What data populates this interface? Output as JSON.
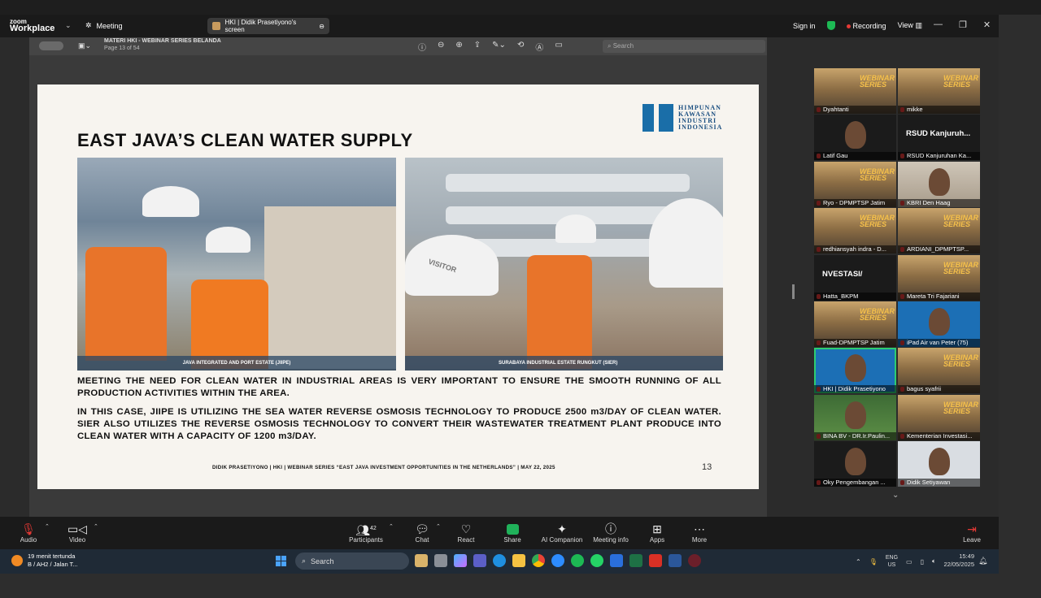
{
  "zoom": {
    "brand_line1": "zoom",
    "brand_line2": "Workplace",
    "meeting_label": "Meeting",
    "screen_chip": "HKI | Didik Prasetiyono's screen",
    "sign_in": "Sign in",
    "recording": "Recording",
    "view": "View"
  },
  "pdf": {
    "doc_title": "MATERI HKI - WEBINAR SERIES BELANDA",
    "page_info": "Page 13 of 54",
    "search_placeholder": "Search"
  },
  "slide": {
    "title": "EAST JAVA’S CLEAN WATER SUPPLY",
    "logo_lines": [
      "HIMPUNAN",
      "KAWASAN",
      "INDUSTRI",
      "INDONESIA"
    ],
    "photo1_caption": "JAVA INTEGRATED AND PORT ESTATE (JIIPE)",
    "photo2_caption": "SURABAYA INDUSTRIAL ESTATE RUNGKUT (SIER)",
    "paragraph1": "MEETING THE NEED FOR CLEAN WATER IN INDUSTRIAL AREAS IS VERY IMPORTANT TO ENSURE THE SMOOTH RUNNING OF ALL PRODUCTION ACTIVITIES WITHIN THE AREA.",
    "paragraph2": "IN THIS CASE, JIIPE IS UTILIZING THE SEA WATER REVERSE OSMOSIS TECHNOLOGY TO PRODUCE 2500 m3/DAY OF CLEAN WATER. SIER ALSO UTILIZES THE REVERSE OSMOSIS TECHNOLOGY TO CONVERT THEIR WASTEWATER TREATMENT PLANT PRODUCE INTO CLEAN WATER WITH A CAPACITY OF 1200 m3/DAY.",
    "footer": "DIDIK PRASETIYONO | HKI | WEBINAR SERIES “EAST JAVA INVESTMENT OPPORTUNITIES IN THE NETHERLANDS” | MAY 22, 2025",
    "page_number": "13",
    "visitor_label": "VISITOR"
  },
  "participants": [
    {
      "name": "Dyahtanti",
      "style": "webinar"
    },
    {
      "name": "mikke",
      "style": "webinar"
    },
    {
      "name": "Latif Gau",
      "style": "dark"
    },
    {
      "name": "RSUD Kanjuruhan Ka...",
      "style": "dark",
      "title": "RSUD  Kanjuruh..."
    },
    {
      "name": "Ryo - DPMPTSP Jatim",
      "style": "webinar"
    },
    {
      "name": "KBRI Den Haag",
      "style": "room"
    },
    {
      "name": "redhiansyah indra - D...",
      "style": "webinar"
    },
    {
      "name": "ARDIANI_DPMPTSP...",
      "style": "webinar"
    },
    {
      "name": "Hatta_BKPM",
      "style": "dark",
      "title": "NVESTASI/"
    },
    {
      "name": "Mareta Tri Fajariani",
      "style": "webinar"
    },
    {
      "name": "Fuad-DPMPTSP Jatim",
      "style": "webinar"
    },
    {
      "name": "iPad Air van Peter (75)",
      "style": "blue"
    },
    {
      "name": "HKI | Didik Prasetiyono",
      "style": "blue",
      "active": true
    },
    {
      "name": "bagus syafrii",
      "style": "webinar"
    },
    {
      "name": "BINA BV - DR.Ir.Paulin...",
      "style": "green"
    },
    {
      "name": "Kementerian Investasi...",
      "style": "webinar"
    },
    {
      "name": "Oky Pengembangan ...",
      "style": "dark"
    },
    {
      "name": "Didik Setiyawan",
      "style": "light"
    }
  ],
  "webinar_tile_text": [
    "WEBINAR",
    "SERIES"
  ],
  "controls": {
    "audio": "Audio",
    "video": "Video",
    "participants": "Participants",
    "participants_count": "42",
    "chat": "Chat",
    "react": "React",
    "share": "Share",
    "ai_companion": "AI Companion",
    "meeting_info": "Meeting info",
    "apps": "Apps",
    "more": "More",
    "leave": "Leave"
  },
  "taskbar": {
    "weather_line1": "19 menit tertunda",
    "weather_line2": "B / AH2 / Jalan T...",
    "search": "Search",
    "lang_line1": "ENG",
    "lang_line2": "US",
    "time": "15:49",
    "date": "22/05/2025"
  },
  "colors": {
    "slide_bg": "#f7f4ef",
    "hki_blue": "#1a6ea8",
    "recording_red": "#e53935",
    "share_green": "#20b25a",
    "active_speaker": "#2ecc71"
  }
}
